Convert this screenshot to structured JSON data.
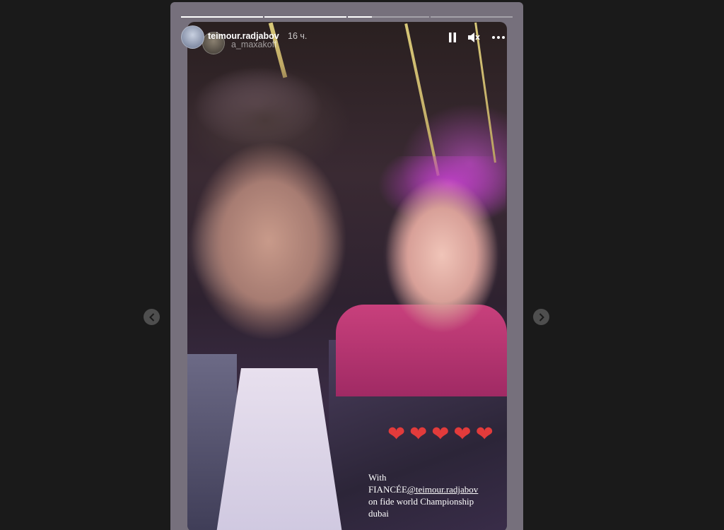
{
  "story": {
    "username": "teimour.radjabov",
    "time_ago": "16 ч.",
    "tagged_user": "a_maxakoff",
    "progress": [
      1,
      1,
      0.3,
      0
    ],
    "caption": {
      "line1": "With",
      "line2_prefix": "FIANCÉE",
      "mention": "@teimour.radjabov",
      "line3": "on fide world Championship",
      "line4": "dubai"
    },
    "hearts": [
      "❤",
      "❤",
      "❤",
      "❤",
      "❤"
    ]
  },
  "icons": {
    "pause": "pause-icon",
    "mute": "speaker-muted-icon",
    "more": "more-options-icon",
    "prev": "chevron-left-icon",
    "next": "chevron-right-icon"
  },
  "colors": {
    "page_bg": "#1a1a1a",
    "frame_bg": "#76707c",
    "heart": "#e23b3b",
    "nav_button": "#4e4e4e"
  }
}
